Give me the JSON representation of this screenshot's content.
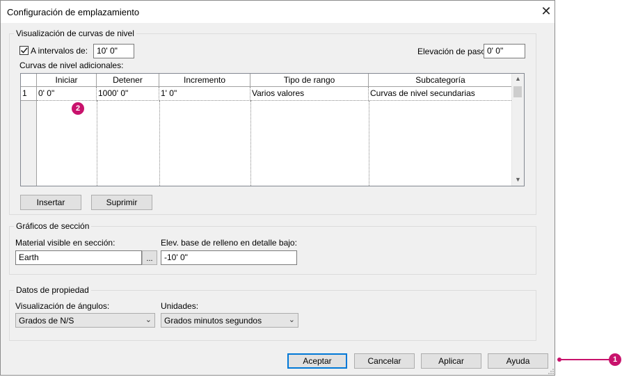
{
  "dialog": {
    "title": "Configuración de emplazamiento",
    "close_glyph": "✕"
  },
  "contours": {
    "group_title": "Visualización de curvas de nivel",
    "interval_checkbox_label": "A intervalos de:",
    "interval_checked": true,
    "interval_value": "10'  0\"",
    "pass_elevation_label": "Elevación de paso:",
    "pass_elevation_value": "0'  0\"",
    "additional_label": "Curvas de nivel adicionales:",
    "table": {
      "headers": [
        "Iniciar",
        "Detener",
        "Incremento",
        "Tipo de rango",
        "Subcategoría"
      ],
      "rows": [
        {
          "num": "1",
          "cells": [
            "0'  0\"",
            "1000'  0\"",
            "1'  0\"",
            "Varios valores",
            "Curvas de nivel secundarias"
          ]
        }
      ]
    },
    "insert_button": "Insertar",
    "delete_button": "Suprimir"
  },
  "section_graphics": {
    "group_title": "Gráficos de sección",
    "material_label": "Material visible en sección:",
    "material_value": "Earth",
    "browse_button": "...",
    "base_elev_label": "Elev. base de relleno en detalle bajo:",
    "base_elev_value": "-10'  0\""
  },
  "property_data": {
    "group_title": "Datos de propiedad",
    "angles_label": "Visualización de ángulos:",
    "angles_value": "Grados de N/S",
    "units_label": "Unidades:",
    "units_value": "Grados minutos segundos"
  },
  "footer": {
    "ok_button": "Aceptar",
    "cancel_button": "Cancelar",
    "apply_button": "Aplicar",
    "help_button": "Ayuda"
  },
  "callouts": {
    "one": "1",
    "two": "2"
  },
  "colors": {
    "callout": "#c8126c",
    "primary_border": "#0078d7"
  }
}
